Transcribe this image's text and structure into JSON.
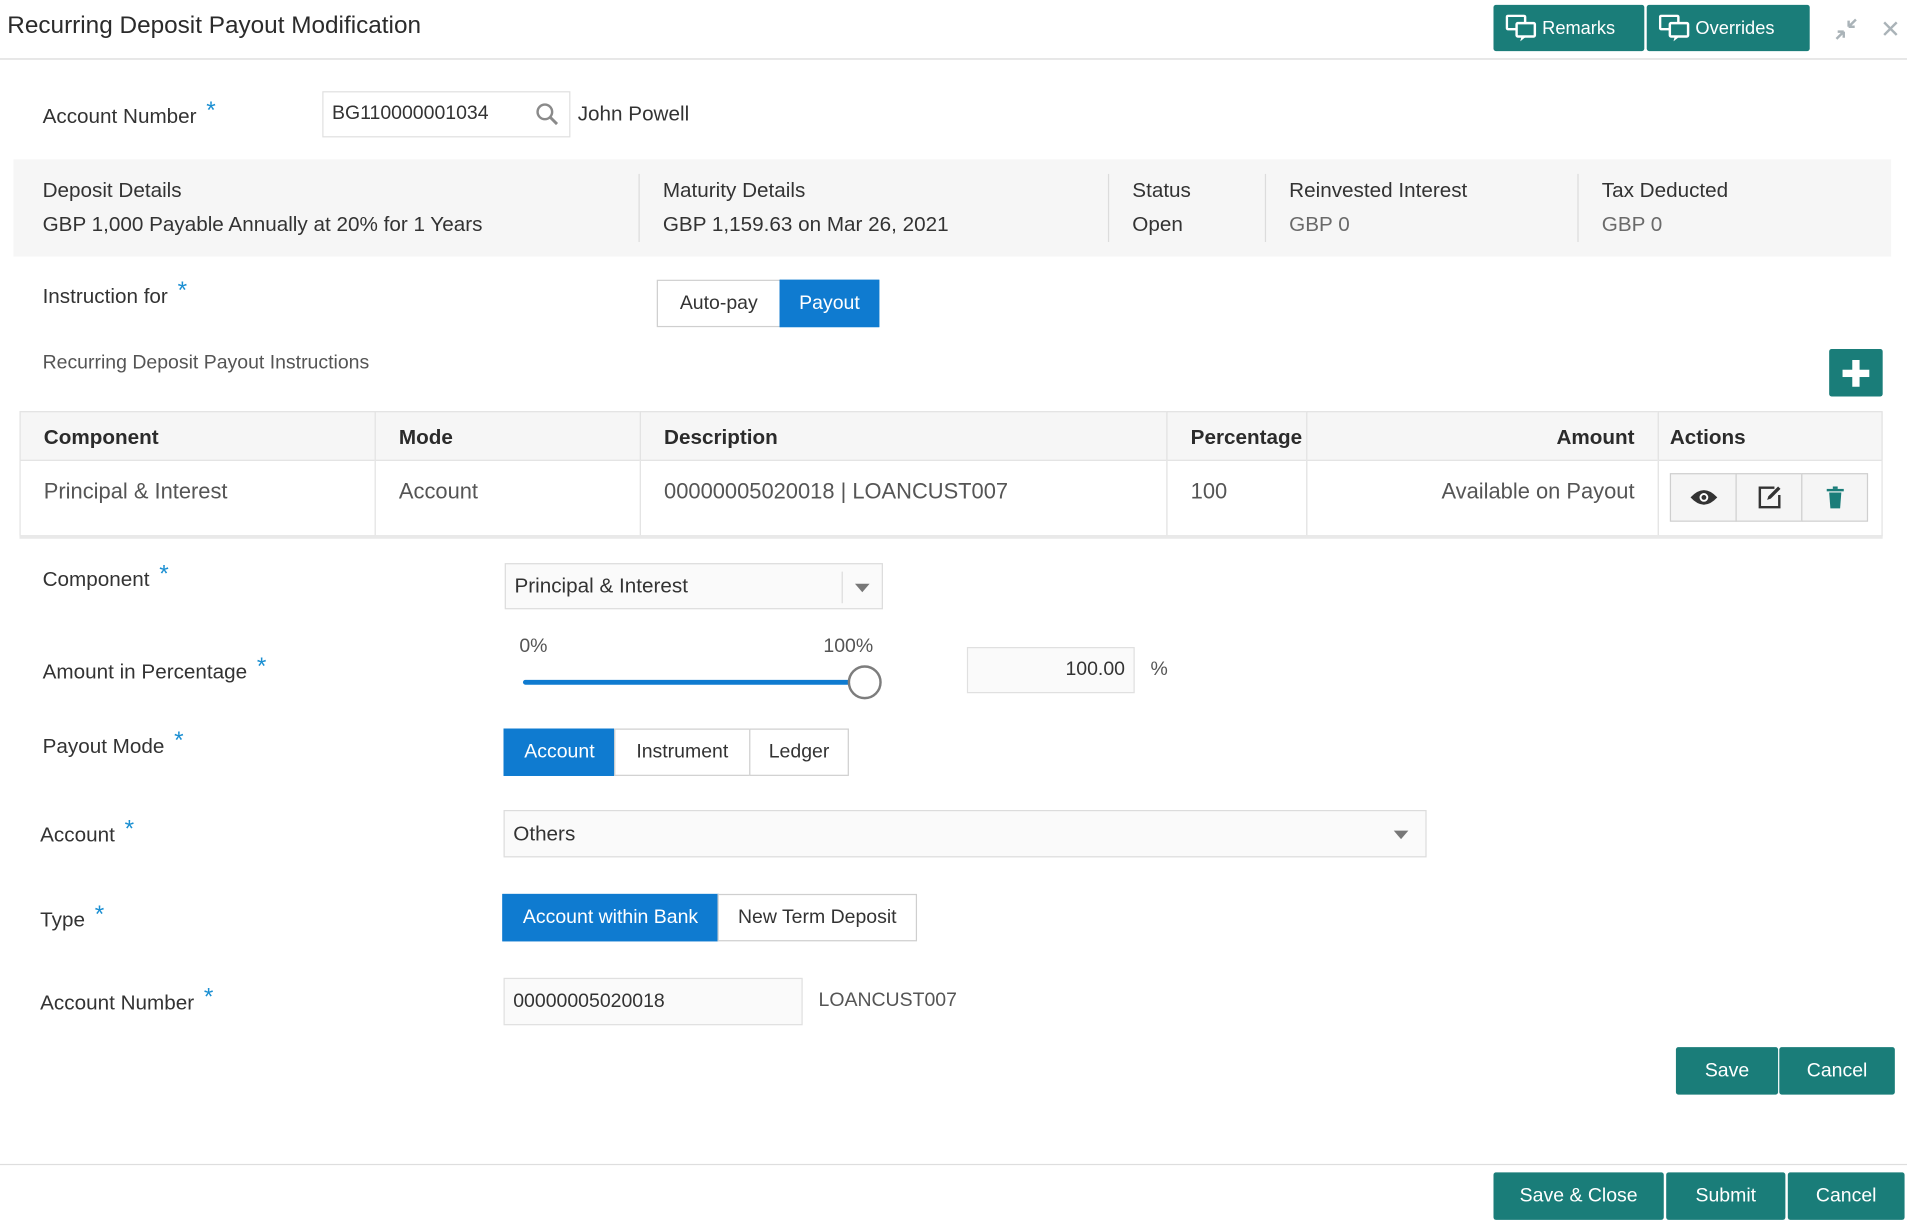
{
  "header": {
    "title": "Recurring Deposit Payout Modification",
    "remarks_label": "Remarks",
    "overrides_label": "Overrides",
    "accent_color": "#1a7d79"
  },
  "account": {
    "label": "Account Number",
    "value": "BG110000001034",
    "customer_name": "John Powell"
  },
  "summary": {
    "deposit_details_label": "Deposit Details",
    "deposit_details_value": "GBP 1,000 Payable Annually at 20% for 1 Years",
    "maturity_details_label": "Maturity Details",
    "maturity_details_value": "GBP 1,159.63 on Mar 26, 2021",
    "status_label": "Status",
    "status_value": "Open",
    "reinvested_interest_label": "Reinvested Interest",
    "reinvested_interest_value": "GBP 0",
    "tax_deducted_label": "Tax Deducted",
    "tax_deducted_value": "GBP 0"
  },
  "instruction_for": {
    "label": "Instruction for",
    "options": [
      "Auto-pay",
      "Payout"
    ],
    "selected": "Payout"
  },
  "instructions_section_title": "Recurring Deposit Payout Instructions",
  "table": {
    "headers": [
      "Component",
      "Mode",
      "Description",
      "Percentage",
      "Amount",
      "Actions"
    ],
    "rows": [
      {
        "component": "Principal & Interest",
        "mode": "Account",
        "description": "00000005020018 | LOANCUST007",
        "percentage": "100",
        "amount": "Available on Payout",
        "actions": [
          "view-icon",
          "edit-icon",
          "delete-icon"
        ]
      }
    ]
  },
  "form": {
    "component_label": "Component",
    "component_value": "Principal & Interest",
    "amount_pct_label": "Amount in Percentage",
    "slider_min_label": "0%",
    "slider_max_label": "100%",
    "slider_level": 1.0,
    "amount_pct_value": "100.00",
    "pct_symbol": "%",
    "payout_mode_label": "Payout Mode",
    "payout_mode_options": [
      "Account",
      "Instrument",
      "Ledger"
    ],
    "payout_mode_selected": "Account",
    "account_label": "Account",
    "account_value": "Others",
    "type_label": "Type",
    "type_options": [
      "Account within Bank",
      "New Term Deposit"
    ],
    "type_selected": "Account within Bank",
    "account_number_label": "Account Number",
    "account_number_value": "00000005020018",
    "account_number_name": "LOANCUST007",
    "required_mark": "*",
    "save_label": "Save",
    "cancel_label": "Cancel"
  },
  "footer": {
    "save_close_label": "Save & Close",
    "submit_label": "Submit",
    "cancel_label": "Cancel"
  }
}
